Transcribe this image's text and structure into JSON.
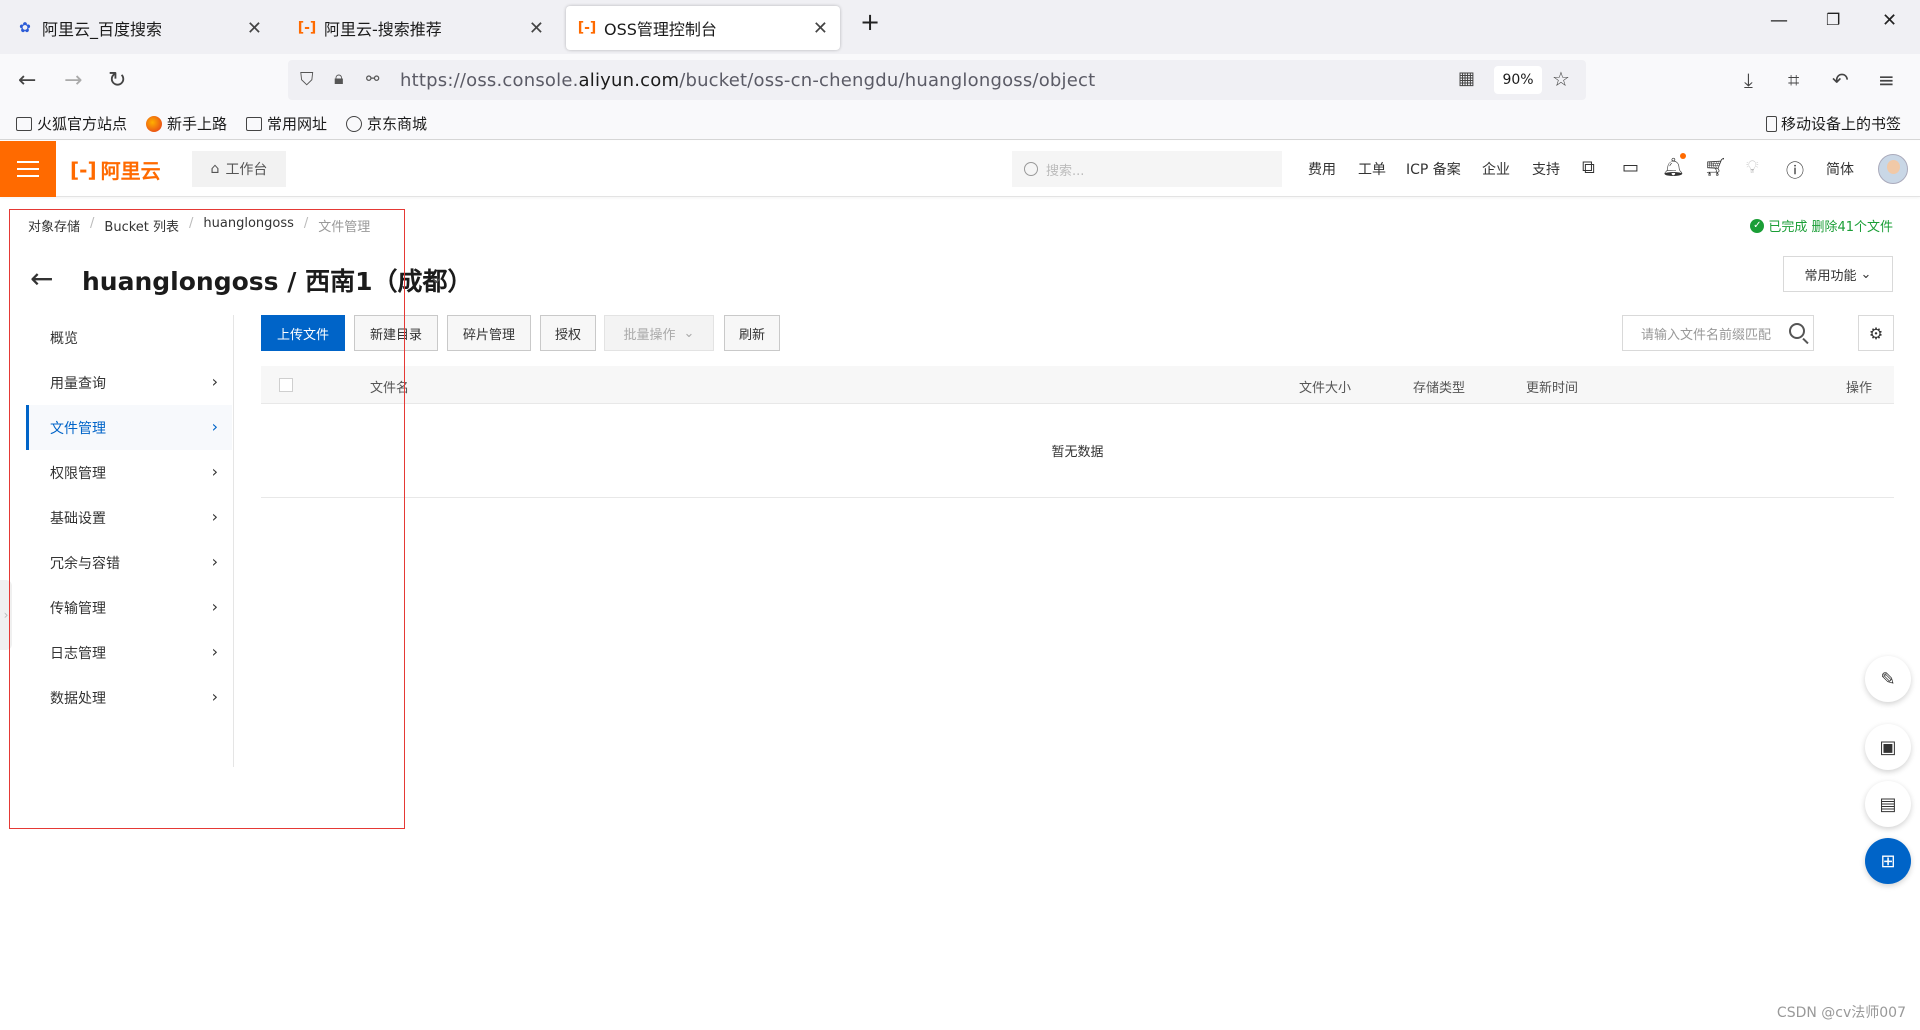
{
  "browser": {
    "tabs": [
      {
        "title": "阿里云_百度搜索",
        "icon": "baidu-paw-icon"
      },
      {
        "title": "阿里云-搜索推荐",
        "icon": "aliyun-logo-icon"
      },
      {
        "title": "OSS管理控制台",
        "icon": "aliyun-logo-icon"
      }
    ],
    "new_tab_label": "+",
    "url_prefix": "https://oss.console.",
    "url_domain": "aliyun.com",
    "url_suffix": "/bucket/oss-cn-chengdu/huanglongoss/object",
    "zoom": "90%",
    "bookmarks": [
      "火狐官方站点",
      "新手上路",
      "常用网址",
      "京东商城"
    ],
    "mobile_bookmarks": "移动设备上的书签"
  },
  "console": {
    "brand": "阿里云",
    "workbench": "工作台",
    "search_placeholder": "搜索...",
    "nav": [
      "费用",
      "工单",
      "ICP 备案",
      "企业",
      "支持"
    ],
    "lang": "简体"
  },
  "breadcrumb": [
    "对象存储",
    "Bucket 列表",
    "huanglongoss",
    "文件管理"
  ],
  "status_text": "已完成 删除41个文件",
  "page_title": "huanglongoss / 西南1（成都）",
  "common_functions": "常用功能",
  "menu": [
    {
      "label": "概览",
      "has_arrow": false
    },
    {
      "label": "用量查询",
      "has_arrow": true
    },
    {
      "label": "文件管理",
      "has_arrow": true,
      "active": true
    },
    {
      "label": "权限管理",
      "has_arrow": true
    },
    {
      "label": "基础设置",
      "has_arrow": true
    },
    {
      "label": "冗余与容错",
      "has_arrow": true
    },
    {
      "label": "传输管理",
      "has_arrow": true
    },
    {
      "label": "日志管理",
      "has_arrow": true
    },
    {
      "label": "数据处理",
      "has_arrow": true
    }
  ],
  "toolbar": {
    "upload": "上传文件",
    "new_dir": "新建目录",
    "fragments": "碎片管理",
    "authorize": "授权",
    "batch": "批量操作",
    "refresh": "刷新",
    "search_placeholder": "请输入文件名前缀匹配"
  },
  "table": {
    "columns": [
      "文件名",
      "文件大小",
      "存储类型",
      "更新时间",
      "操作"
    ],
    "empty_text": "暂无数据"
  },
  "watermark": "CSDN @cv法师007",
  "colors": {
    "brand_orange": "#ff6a00",
    "primary_blue": "#0064c8",
    "success_green": "#1a9e36",
    "annotation_red": "#e53935"
  }
}
